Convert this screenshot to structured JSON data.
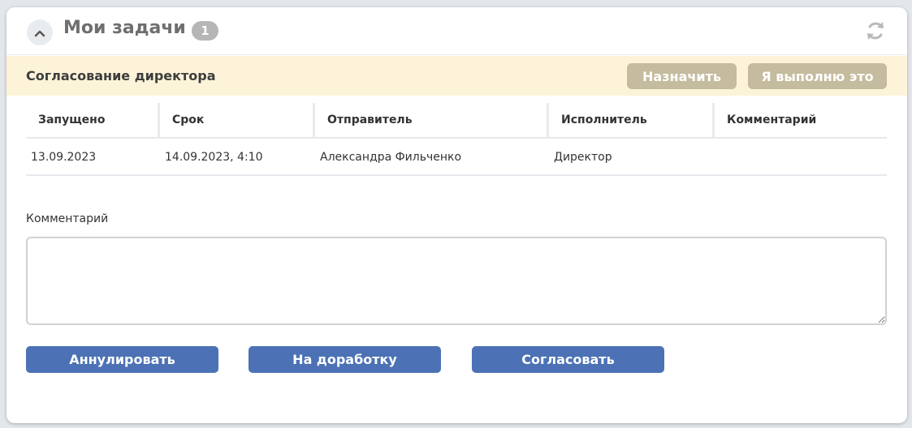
{
  "widget": {
    "title": "Мои задачи",
    "count": "1",
    "icons": {
      "collapse": "chevron-up-icon",
      "refresh": "refresh-icon"
    }
  },
  "task": {
    "title": "Согласование директора",
    "assign_label": "Назначить",
    "take_label": "Я выполню это"
  },
  "table": {
    "headers": [
      "Запущено",
      "Срок",
      "Отправитель",
      "Исполнитель",
      "Комментарий"
    ],
    "rows": [
      [
        "13.09.2023",
        "14.09.2023, 4:10",
        "Александра Фильченко",
        "Директор",
        ""
      ]
    ]
  },
  "comment": {
    "label": "Комментарий",
    "value": "",
    "placeholder": ""
  },
  "actions": {
    "cancel_label": "Аннулировать",
    "rework_label": "На доработку",
    "approve_label": "Согласовать"
  },
  "colors": {
    "accent_blue": "#4c72b5",
    "beige_button": "#c5bb9e",
    "task_bar_bg": "#fcf3d9",
    "badge_gray": "#b6b6b6"
  }
}
